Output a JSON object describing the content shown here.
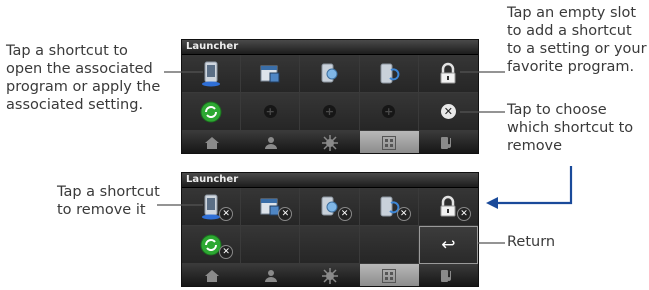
{
  "annotations": {
    "tap_shortcut_open": [
      "Tap a shortcut to",
      "open the associated",
      "program or apply the",
      "associated setting."
    ],
    "tap_empty_slot": [
      "Tap an empty slot",
      "to add a shortcut",
      "to a setting or your",
      "favorite program."
    ],
    "tap_choose_remove": [
      "Tap to choose",
      "which shortcut to",
      "remove"
    ],
    "tap_shortcut_remove": [
      "Tap a shortcut",
      "to remove it"
    ],
    "return": "Return"
  },
  "panel_top": {
    "title": "Launcher",
    "row1": [
      "phone-icon",
      "calendar-icon",
      "lightbulb-icon",
      "sync-icon",
      "lock-icon"
    ],
    "row2": [
      "green-refresh-icon",
      "plus",
      "plus",
      "plus",
      "remove-x"
    ],
    "bottom_bar": [
      "home-icon",
      "contacts-icon",
      "settings-icon",
      "launcher-icon",
      "music-icon"
    ],
    "active_tab": 3
  },
  "panel_bottom": {
    "title": "Launcher",
    "row1": [
      "phone-icon",
      "calendar-icon",
      "lightbulb-icon",
      "sync-icon",
      "lock-icon"
    ],
    "row2": [
      "green-refresh-icon",
      "empty",
      "empty",
      "empty",
      "return-icon"
    ],
    "bottom_bar": [
      "home-icon",
      "contacts-icon",
      "settings-icon",
      "launcher-icon",
      "music-icon"
    ],
    "active_tab": 3
  },
  "colors": {
    "panel_bg": "#2b2b2b",
    "accent_line": "#1a4a9a",
    "text": "#3a3a3a",
    "green": "#2da832"
  },
  "glyphs": {
    "plus": "+",
    "x": "✕",
    "return": "↩"
  }
}
